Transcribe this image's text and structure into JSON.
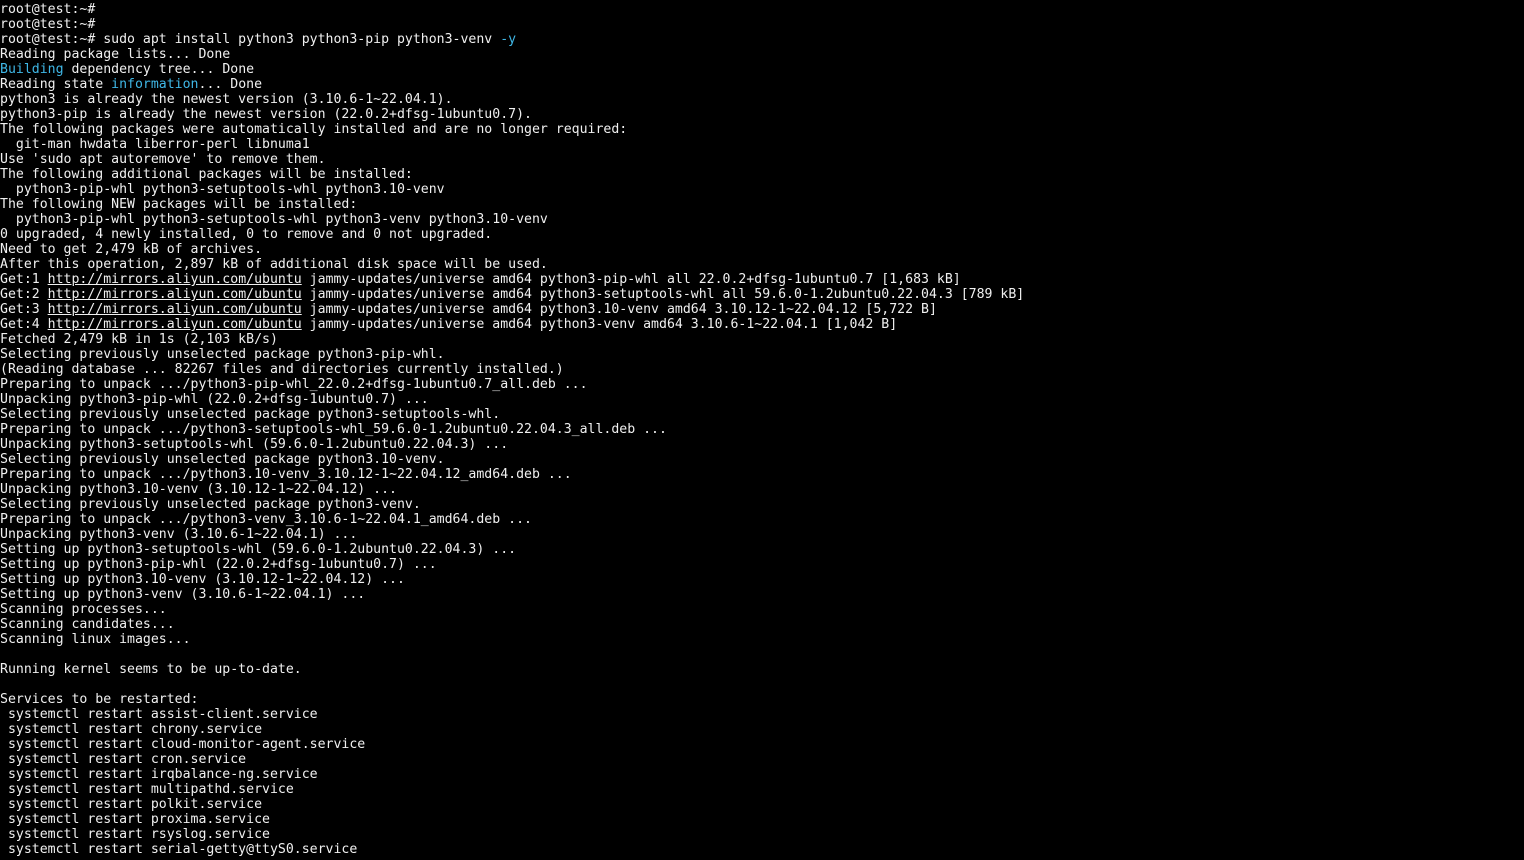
{
  "terminal": {
    "colors": {
      "background": "#000000",
      "foreground": "#f0f0f0",
      "highlight": "#3fb7e6"
    },
    "lines": [
      [
        {
          "t": "root@test:~#"
        }
      ],
      [
        {
          "t": "root@test:~#"
        }
      ],
      [
        {
          "t": "root@test:~# sudo apt install python3 python3-pip python3-venv "
        },
        {
          "t": "-y",
          "s": "cyan"
        }
      ],
      [
        {
          "t": "Reading package lists... Done"
        }
      ],
      [
        {
          "t": "Building",
          "s": "cyan"
        },
        {
          "t": " dependency tree... Done"
        }
      ],
      [
        {
          "t": "Reading state "
        },
        {
          "t": "information",
          "s": "cyan"
        },
        {
          "t": "... Done"
        }
      ],
      [
        {
          "t": "python3 is already the newest version (3.10.6-1~22.04.1)."
        }
      ],
      [
        {
          "t": "python3-pip is already the newest version (22.0.2+dfsg-1ubuntu0.7)."
        }
      ],
      [
        {
          "t": "The following packages were automatically installed and are no longer required:"
        }
      ],
      [
        {
          "t": "  git-man hwdata liberror-perl libnuma1"
        }
      ],
      [
        {
          "t": "Use 'sudo apt autoremove' to remove them."
        }
      ],
      [
        {
          "t": "The following additional packages will be installed:"
        }
      ],
      [
        {
          "t": "  python3-pip-whl python3-setuptools-whl python3.10-venv"
        }
      ],
      [
        {
          "t": "The following NEW packages will be installed:"
        }
      ],
      [
        {
          "t": "  python3-pip-whl python3-setuptools-whl python3-venv python3.10-venv"
        }
      ],
      [
        {
          "t": "0 upgraded, 4 newly installed, 0 to remove and 0 not upgraded."
        }
      ],
      [
        {
          "t": "Need to get 2,479 kB of archives."
        }
      ],
      [
        {
          "t": "After this operation, 2,897 kB of additional disk space will be used."
        }
      ],
      [
        {
          "t": "Get:1 "
        },
        {
          "t": "http://mirrors.aliyun.com/ubuntu",
          "s": "url"
        },
        {
          "t": " jammy-updates/universe amd64 python3-pip-whl all 22.0.2+dfsg-1ubuntu0.7 [1,683 kB]"
        }
      ],
      [
        {
          "t": "Get:2 "
        },
        {
          "t": "http://mirrors.aliyun.com/ubuntu",
          "s": "url"
        },
        {
          "t": " jammy-updates/universe amd64 python3-setuptools-whl all 59.6.0-1.2ubuntu0.22.04.3 [789 kB]"
        }
      ],
      [
        {
          "t": "Get:3 "
        },
        {
          "t": "http://mirrors.aliyun.com/ubuntu",
          "s": "url"
        },
        {
          "t": " jammy-updates/universe amd64 python3.10-venv amd64 3.10.12-1~22.04.12 [5,722 B]"
        }
      ],
      [
        {
          "t": "Get:4 "
        },
        {
          "t": "http://mirrors.aliyun.com/ubuntu",
          "s": "url"
        },
        {
          "t": " jammy-updates/universe amd64 python3-venv amd64 3.10.6-1~22.04.1 [1,042 B]"
        }
      ],
      [
        {
          "t": "Fetched 2,479 kB in 1s (2,103 kB/s)"
        }
      ],
      [
        {
          "t": "Selecting previously unselected package python3-pip-whl."
        }
      ],
      [
        {
          "t": "(Reading database ... 82267 files and directories currently installed.)"
        }
      ],
      [
        {
          "t": "Preparing to unpack .../python3-pip-whl_22.0.2+dfsg-1ubuntu0.7_all.deb ..."
        }
      ],
      [
        {
          "t": "Unpacking python3-pip-whl (22.0.2+dfsg-1ubuntu0.7) ..."
        }
      ],
      [
        {
          "t": "Selecting previously unselected package python3-setuptools-whl."
        }
      ],
      [
        {
          "t": "Preparing to unpack .../python3-setuptools-whl_59.6.0-1.2ubuntu0.22.04.3_all.deb ..."
        }
      ],
      [
        {
          "t": "Unpacking python3-setuptools-whl (59.6.0-1.2ubuntu0.22.04.3) ..."
        }
      ],
      [
        {
          "t": "Selecting previously unselected package python3.10-venv."
        }
      ],
      [
        {
          "t": "Preparing to unpack .../python3.10-venv_3.10.12-1~22.04.12_amd64.deb ..."
        }
      ],
      [
        {
          "t": "Unpacking python3.10-venv (3.10.12-1~22.04.12) ..."
        }
      ],
      [
        {
          "t": "Selecting previously unselected package python3-venv."
        }
      ],
      [
        {
          "t": "Preparing to unpack .../python3-venv_3.10.6-1~22.04.1_amd64.deb ..."
        }
      ],
      [
        {
          "t": "Unpacking python3-venv (3.10.6-1~22.04.1) ..."
        }
      ],
      [
        {
          "t": "Setting up python3-setuptools-whl (59.6.0-1.2ubuntu0.22.04.3) ..."
        }
      ],
      [
        {
          "t": "Setting up python3-pip-whl (22.0.2+dfsg-1ubuntu0.7) ..."
        }
      ],
      [
        {
          "t": "Setting up python3.10-venv (3.10.12-1~22.04.12) ..."
        }
      ],
      [
        {
          "t": "Setting up python3-venv (3.10.6-1~22.04.1) ..."
        }
      ],
      [
        {
          "t": "Scanning processes..."
        }
      ],
      [
        {
          "t": "Scanning candidates..."
        }
      ],
      [
        {
          "t": "Scanning linux images..."
        }
      ],
      [
        {
          "t": ""
        }
      ],
      [
        {
          "t": "Running kernel seems to be up-to-date."
        }
      ],
      [
        {
          "t": ""
        }
      ],
      [
        {
          "t": "Services to be restarted:"
        }
      ],
      [
        {
          "t": " systemctl restart assist-client.service"
        }
      ],
      [
        {
          "t": " systemctl restart chrony.service"
        }
      ],
      [
        {
          "t": " systemctl restart cloud-monitor-agent.service"
        }
      ],
      [
        {
          "t": " systemctl restart cron.service"
        }
      ],
      [
        {
          "t": " systemctl restart irqbalance-ng.service"
        }
      ],
      [
        {
          "t": " systemctl restart multipathd.service"
        }
      ],
      [
        {
          "t": " systemctl restart polkit.service"
        }
      ],
      [
        {
          "t": " systemctl restart proxima.service"
        }
      ],
      [
        {
          "t": " systemctl restart rsyslog.service"
        }
      ],
      [
        {
          "t": " systemctl restart serial-getty@ttyS0.service"
        }
      ]
    ]
  }
}
